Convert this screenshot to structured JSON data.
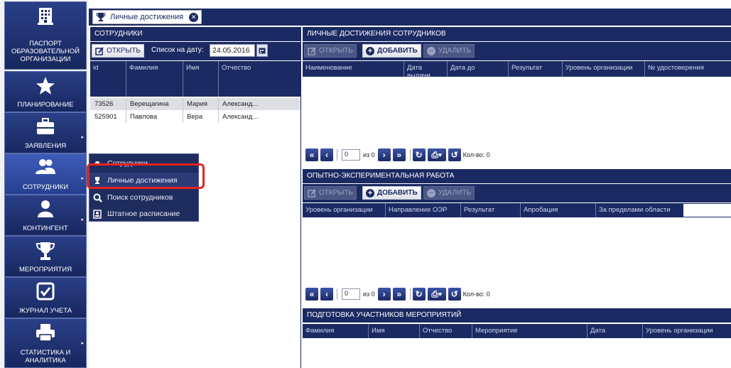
{
  "tab": {
    "label": "Личные достижения"
  },
  "nav": {
    "items": [
      {
        "label_lines": [
          "Паспорт",
          "образовательной",
          "организации"
        ],
        "icon": "building-icon"
      },
      {
        "label_lines": [
          "Планирование"
        ],
        "icon": "star-icon"
      },
      {
        "label_lines": [
          "Заявления"
        ],
        "icon": "briefcase-icon"
      },
      {
        "label_lines": [
          "Сотрудники"
        ],
        "icon": "people-icon"
      },
      {
        "label_lines": [
          "Контингент"
        ],
        "icon": "person-icon"
      },
      {
        "label_lines": [
          "Мероприятия"
        ],
        "icon": "trophy-icon"
      },
      {
        "label_lines": [
          "Журнал учета"
        ],
        "icon": "checkbox-icon"
      },
      {
        "label_lines": [
          "Статистика и",
          "аналитика"
        ],
        "icon": "printer-icon"
      }
    ]
  },
  "employees": {
    "title": "Сотрудники",
    "open_label": "ОТКРЫТЬ",
    "date_label": "Список на дату:",
    "date_value": "24.05.2016",
    "columns": [
      "id",
      "Фамилия",
      "Имя",
      "Отчество"
    ],
    "rows": [
      [
        "73526",
        "Верещагина",
        "Мария",
        "Александ..."
      ],
      [
        "525901",
        "Павлова",
        "Вера",
        "Александ..."
      ]
    ]
  },
  "context_menu": {
    "items": [
      "Сотрудники",
      "Личные достижения",
      "Поиск сотрудников",
      "Штатное расписание"
    ],
    "highlight_color": "#e8221b"
  },
  "achievements": {
    "title": "Личные достижения сотрудников",
    "buttons": {
      "open": "ОТКРЫТЬ",
      "add": "ДОБАВИТЬ",
      "delete": "УДАЛИТЬ"
    },
    "columns": [
      "Наименование",
      "Дата выдачи",
      "Дата до",
      "Результат",
      "Уровень организации",
      "№ удостоверения"
    ],
    "pager": {
      "page": "0",
      "of": "из 0",
      "count": "Кол-во: 0"
    }
  },
  "experimental": {
    "title": "Опытно-экспериментальная работа",
    "buttons": {
      "open": "ОТКРЫТЬ",
      "add": "ДОБАВИТЬ",
      "delete": "УДАЛИТЬ"
    },
    "columns": [
      "Уровень организации",
      "Направление ОЭР",
      "Результат",
      "Апробация",
      "За пределами области"
    ],
    "pager": {
      "page": "0",
      "of": "из 0",
      "count": "Кол-во: 0"
    }
  },
  "training": {
    "title": "Подготовка участников мероприятий",
    "columns": [
      "Фамилия",
      "Имя",
      "Отчество",
      "Мероприятие",
      "Дата",
      "Уровень организации"
    ]
  }
}
